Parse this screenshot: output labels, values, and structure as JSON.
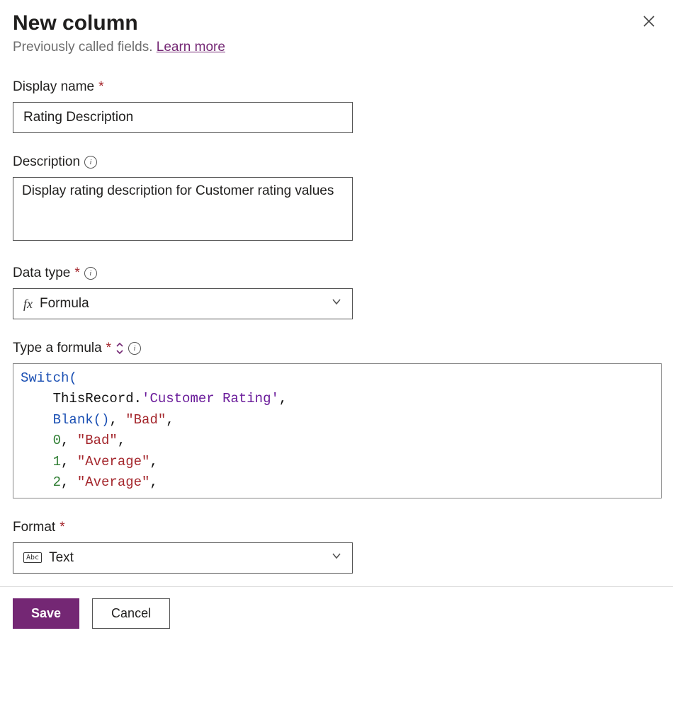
{
  "header": {
    "title": "New column",
    "subtitle_prefix": "Previously called fields. ",
    "learn_more": "Learn more"
  },
  "display_name": {
    "label": "Display name",
    "value": "Rating Description"
  },
  "description": {
    "label": "Description",
    "value": "Display rating description for Customer rating values"
  },
  "data_type": {
    "label": "Data type",
    "value": "Formula"
  },
  "formula": {
    "label": "Type a formula",
    "tokens": [
      {
        "t": "Switch",
        "c": "fn"
      },
      {
        "t": "(",
        "c": "punc"
      },
      {
        "t": "\n    ",
        "c": "txt"
      },
      {
        "t": "ThisRecord",
        "c": "txt"
      },
      {
        "t": ".",
        "c": "txt"
      },
      {
        "t": "'Customer Rating'",
        "c": "prop"
      },
      {
        "t": ",",
        "c": "txt"
      },
      {
        "t": "\n    ",
        "c": "txt"
      },
      {
        "t": "Blank",
        "c": "fn"
      },
      {
        "t": "()",
        "c": "punc"
      },
      {
        "t": ", ",
        "c": "txt"
      },
      {
        "t": "\"Bad\"",
        "c": "str"
      },
      {
        "t": ",",
        "c": "txt"
      },
      {
        "t": "\n    ",
        "c": "txt"
      },
      {
        "t": "0",
        "c": "num"
      },
      {
        "t": ", ",
        "c": "txt"
      },
      {
        "t": "\"Bad\"",
        "c": "str"
      },
      {
        "t": ",",
        "c": "txt"
      },
      {
        "t": "\n    ",
        "c": "txt"
      },
      {
        "t": "1",
        "c": "num"
      },
      {
        "t": ", ",
        "c": "txt"
      },
      {
        "t": "\"Average\"",
        "c": "str"
      },
      {
        "t": ",",
        "c": "txt"
      },
      {
        "t": "\n    ",
        "c": "txt"
      },
      {
        "t": "2",
        "c": "num"
      },
      {
        "t": ", ",
        "c": "txt"
      },
      {
        "t": "\"Average\"",
        "c": "str"
      },
      {
        "t": ",",
        "c": "txt"
      }
    ]
  },
  "format": {
    "label": "Format",
    "value": "Text"
  },
  "buttons": {
    "save": "Save",
    "cancel": "Cancel"
  }
}
